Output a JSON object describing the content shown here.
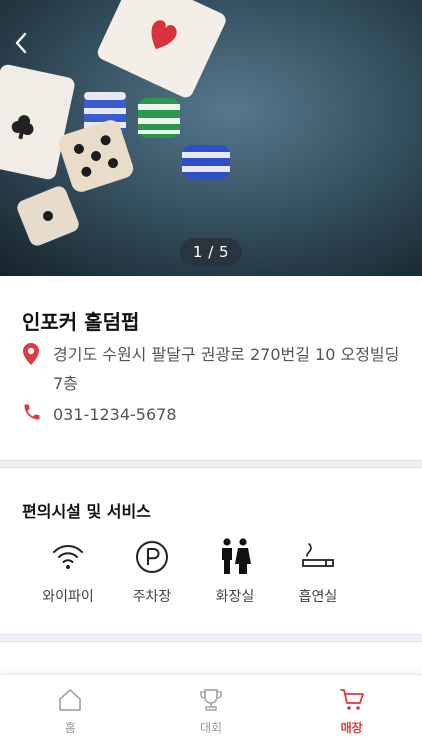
{
  "hero": {
    "pager": "1 / 5",
    "back_icon": "chevron-left-icon"
  },
  "store": {
    "name": "인포커 홀덤펍",
    "address": "경기도 수원시 팔달구 권광로 270번길 10 오정빌딩 7층",
    "phone": "031-1234-5678",
    "accent_color": "#e0393e"
  },
  "facilities": {
    "title": "편의시설 및 서비스",
    "items": [
      {
        "label": "와이파이",
        "icon": "wifi-icon"
      },
      {
        "label": "주차장",
        "icon": "parking-icon"
      },
      {
        "label": "화장실",
        "icon": "restroom-icon"
      },
      {
        "label": "흡연실",
        "icon": "smoking-icon"
      }
    ]
  },
  "nav": {
    "items": [
      {
        "label": "홈",
        "icon": "home-icon"
      },
      {
        "label": "대회",
        "icon": "trophy-icon"
      },
      {
        "label": "매장",
        "icon": "cart-icon",
        "active": true
      }
    ]
  }
}
